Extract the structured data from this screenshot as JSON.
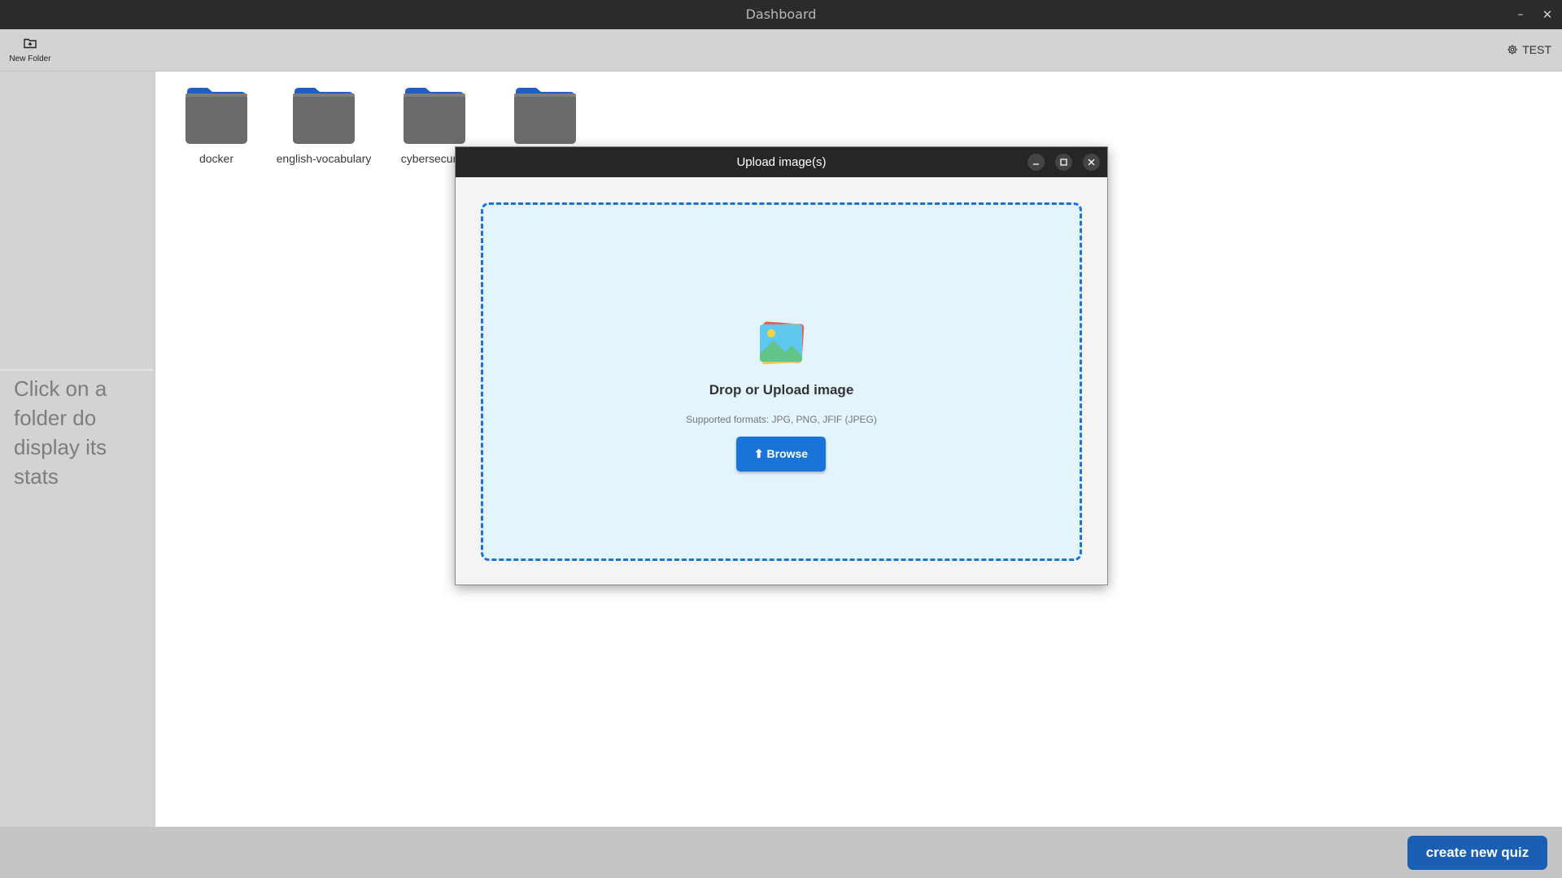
{
  "window": {
    "title": "Dashboard",
    "minimize_glyph": "–",
    "close_glyph": "✕"
  },
  "toolbar": {
    "new_folder_label": "New Folder",
    "new_folder_icon": "folder-plus-icon",
    "settings_label": "TEST",
    "settings_icon": "gear-icon"
  },
  "sidebar": {
    "hint": "Click on a folder do display its stats"
  },
  "folders": [
    {
      "name": "docker"
    },
    {
      "name": "english-vocabulary"
    },
    {
      "name": "cybersecurity"
    },
    {
      "name": ""
    }
  ],
  "folder_colors": {
    "tab": "#1f5fc4",
    "body": "#6b6b6b"
  },
  "dialog": {
    "title": "Upload image(s)",
    "drop_title": "Drop or Upload image",
    "formats": "Supported formats: JPG, PNG, JFIF (JPEG)",
    "browse_label": "⬆ Browse",
    "image_icon": "image-gallery-icon"
  },
  "bottom": {
    "create_quiz_label": "create new quiz"
  },
  "colors": {
    "accent": "#1a73d9",
    "create_button": "#1a5fb4",
    "titlebar": "#2b2b2b"
  }
}
